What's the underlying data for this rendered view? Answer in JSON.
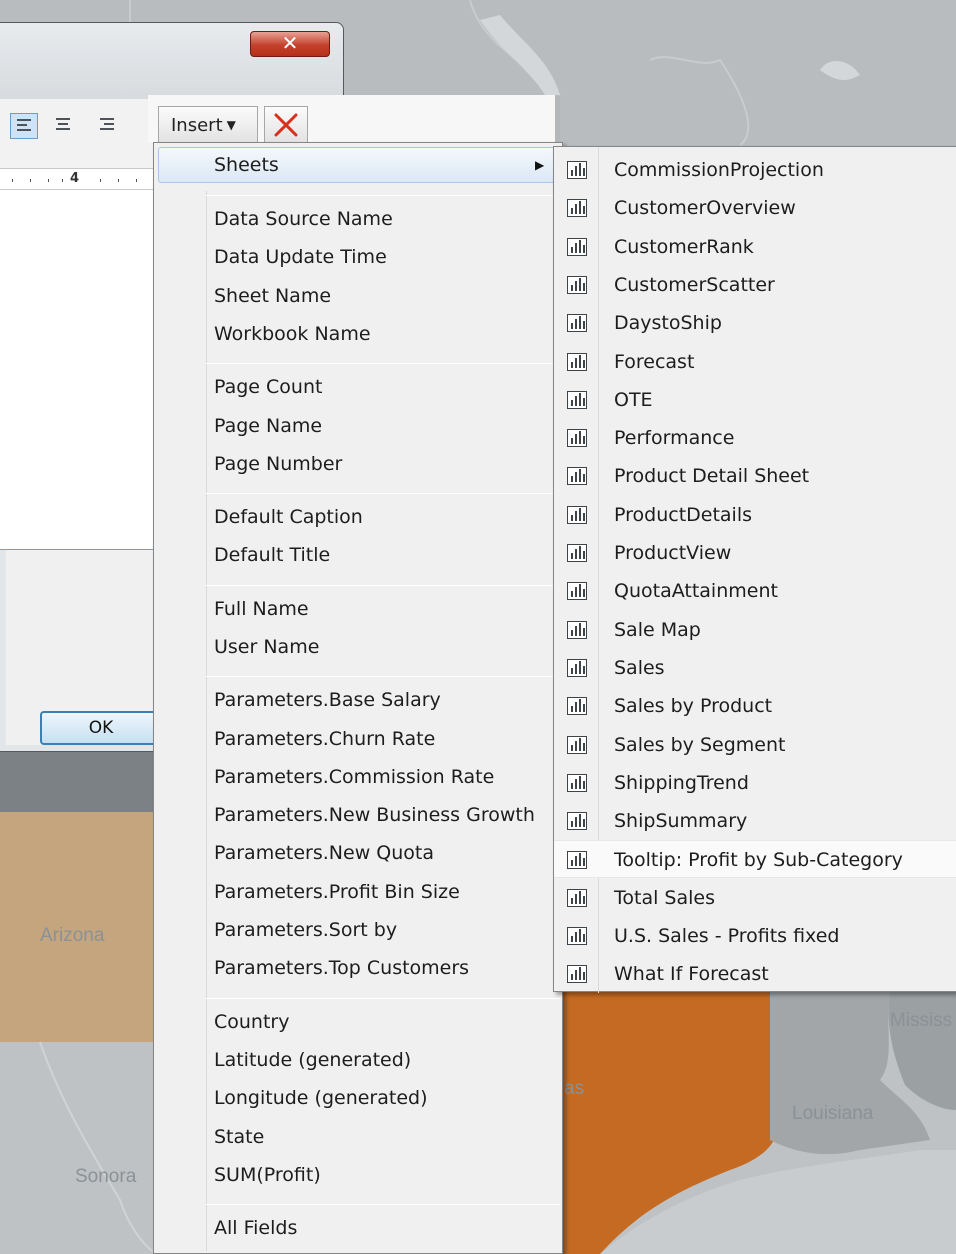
{
  "map": {
    "labels": [
      "Arizona",
      "Sonora",
      "Louisiana",
      "Mississ",
      "as"
    ]
  },
  "dialog": {
    "close_glyph": "✕",
    "ruler_number": "4",
    "ok_label": "OK"
  },
  "toolbar": {
    "insert_label": "Insert",
    "insert_arrow": "▼",
    "delete_glyph": "✕"
  },
  "insert_menu": {
    "sheets_label": "Sheets",
    "sheets_arrow": "▶",
    "groups": [
      [
        "Data Source Name",
        "Data Update Time",
        "Sheet Name",
        "Workbook Name"
      ],
      [
        "Page Count",
        "Page Name",
        "Page Number"
      ],
      [
        "Default Caption",
        "Default Title"
      ],
      [
        "Full Name",
        "User Name"
      ],
      [
        "Parameters.Base Salary",
        "Parameters.Churn Rate",
        "Parameters.Commission Rate",
        "Parameters.New Business Growth",
        "Parameters.New Quota",
        "Parameters.Profit Bin Size",
        "Parameters.Sort by",
        "Parameters.Top Customers"
      ],
      [
        "Country",
        "Latitude (generated)",
        "Longitude (generated)",
        "State",
        "SUM(Profit)"
      ],
      [
        "All Fields"
      ]
    ]
  },
  "sheets_menu": {
    "icon": "bar-chart-icon",
    "highlighted_item": "Tooltip: Profit by Sub-Category",
    "items": [
      "CommissionProjection",
      "CustomerOverview",
      "CustomerRank",
      "CustomerScatter",
      "DaystoShip",
      "Forecast",
      "OTE",
      "Performance",
      "Product Detail Sheet",
      "ProductDetails",
      "ProductView",
      "QuotaAttainment",
      "Sale Map",
      "Sales",
      "Sales by Product",
      "Sales by Segment",
      "ShippingTrend",
      "ShipSummary",
      "Tooltip: Profit by Sub-Category",
      "Total Sales",
      "U.S. Sales - Profits fixed",
      "What If Forecast"
    ]
  },
  "colors": {
    "highlight_state": "#c46a22",
    "arizona_fill": "#c4a57e",
    "neutral_state": "#a2a6a9",
    "water": "#c9ccce"
  }
}
